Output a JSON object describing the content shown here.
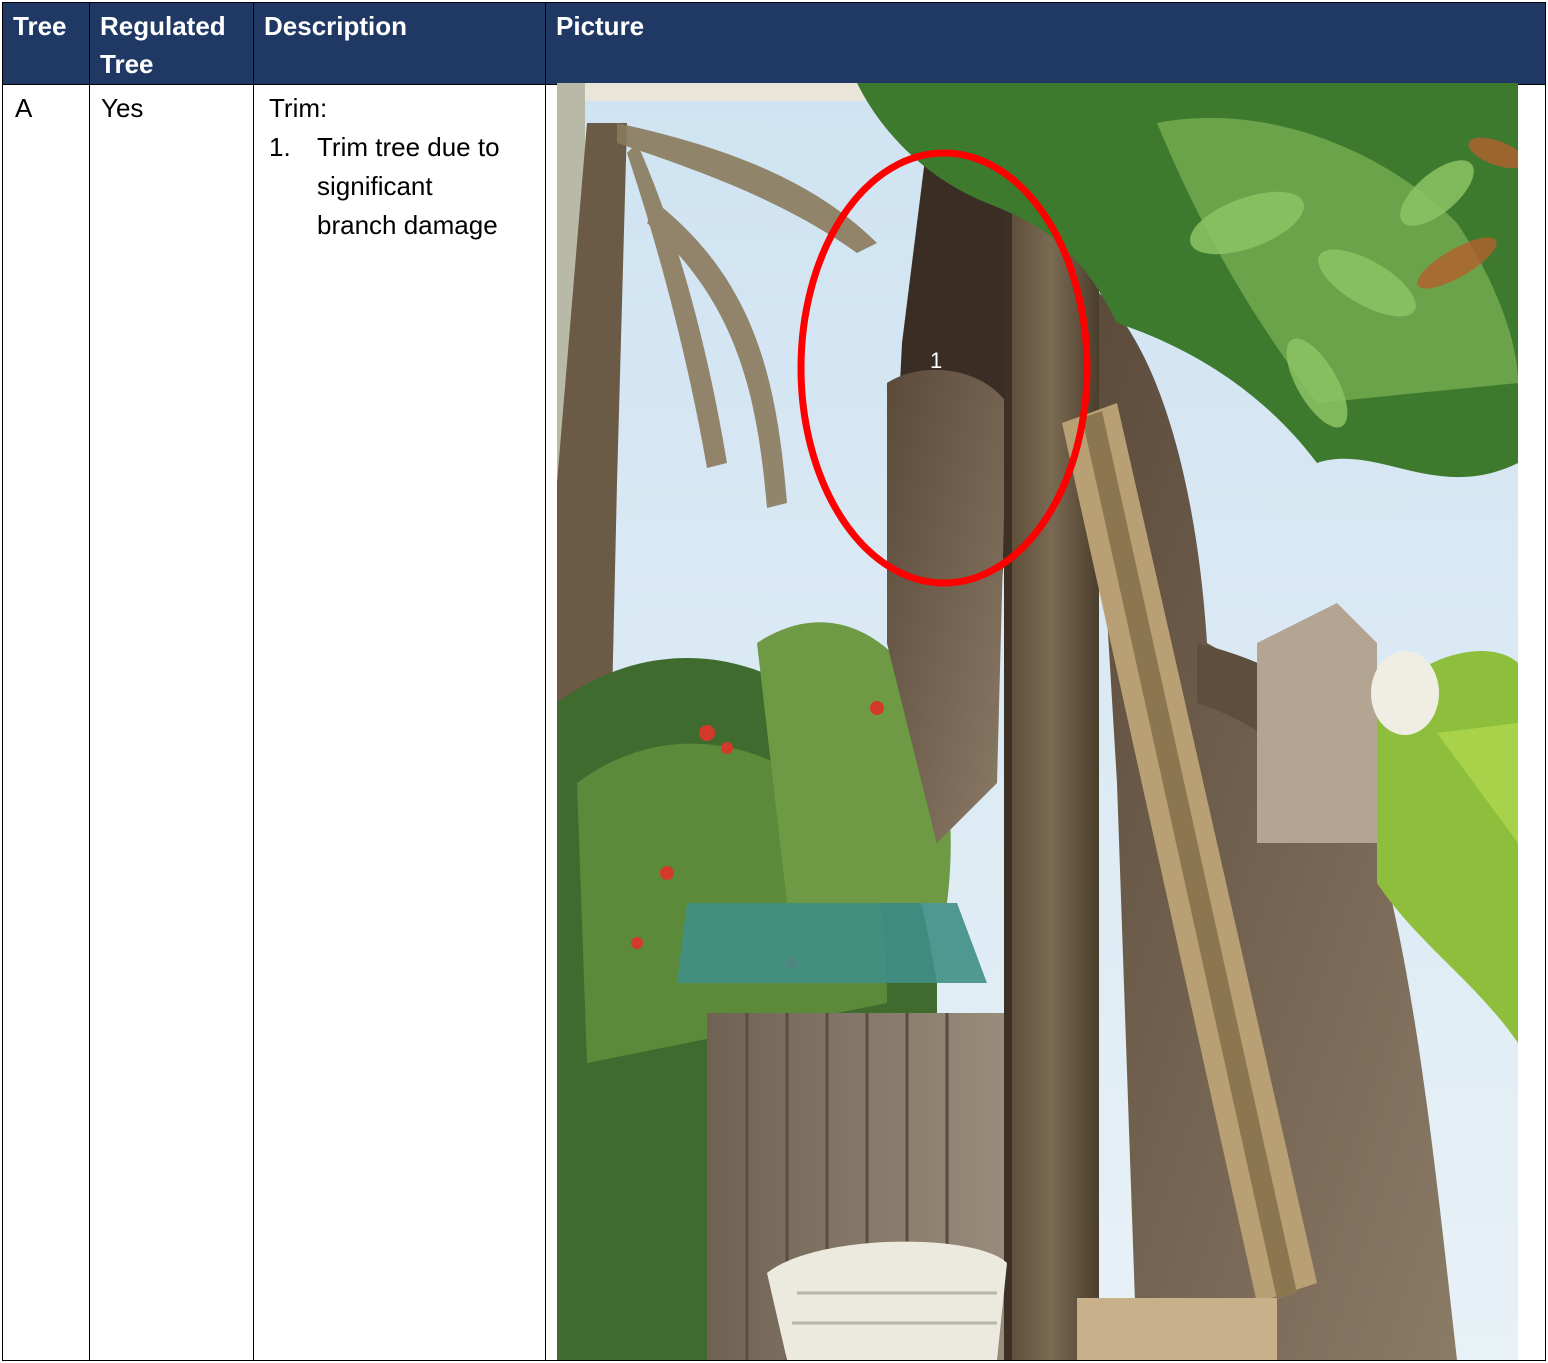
{
  "headers": [
    "Tree",
    "Regulated\nTree",
    "Description",
    "Picture"
  ],
  "headers_display": {
    "tree": "Tree",
    "regulated_line1": "Regulated",
    "regulated_line2": "Tree",
    "description": "Description",
    "picture": "Picture"
  },
  "rows": [
    {
      "tree": "A",
      "regulated": "Yes",
      "description_title": "Trim:",
      "description_items": [
        {
          "num": "1.",
          "line1": "Trim tree due to",
          "line2": "significant",
          "line3": "branch damage"
        }
      ],
      "picture": {
        "annotation_marker": "1",
        "annotation_color": "#ff0000"
      }
    }
  ],
  "colors": {
    "header_bg": "#1f3864",
    "header_text": "#ffffff",
    "border": "#000000"
  }
}
